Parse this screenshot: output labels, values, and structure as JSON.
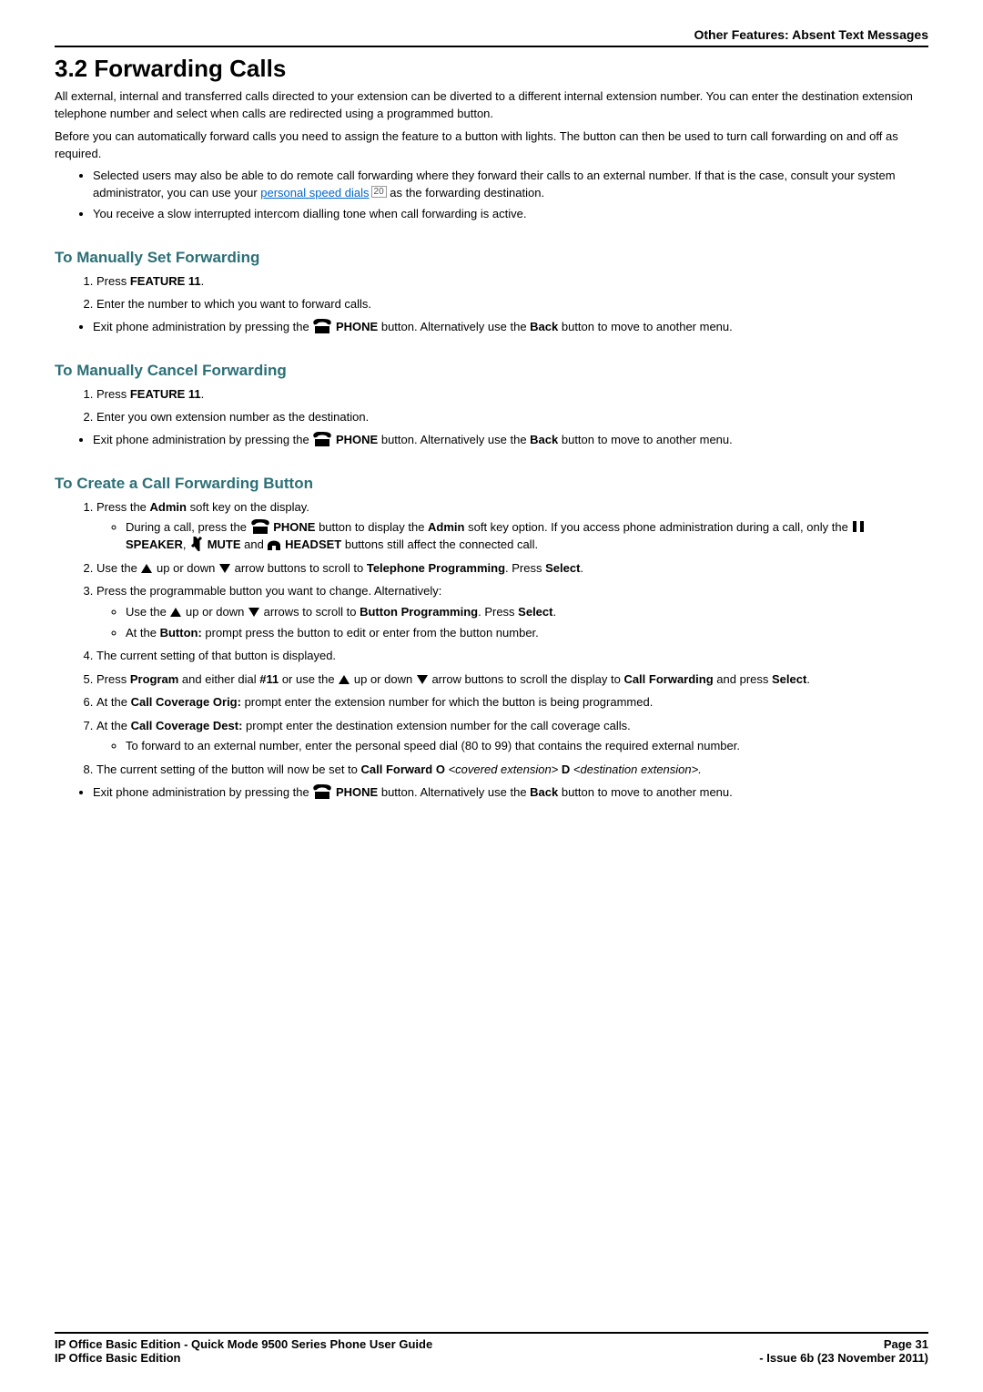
{
  "header": {
    "right": "Other Features: Absent Text Messages"
  },
  "title": "3.2 Forwarding Calls",
  "intro": {
    "p1": "All external, internal and transferred calls directed to your extension can be diverted to a different internal extension number. You can enter the destination extension telephone number and select when calls are redirected using a programmed button.",
    "p2": "Before you can automatically forward calls you need to assign the feature to a button with lights. The button can then be used to turn call forwarding on and off as required.",
    "b1a": "Selected users may also be able to do remote call forwarding where they forward their calls to an external number. If that is the case, consult your system administrator, you can use your ",
    "b1_link": "personal speed dials",
    "b1_sup": "20",
    "b1b": " as the forwarding destination.",
    "b2": "You receive a slow interrupted intercom dialling tone when call forwarding is active."
  },
  "set": {
    "title": "To Manually Set Forwarding",
    "s1a": "Press ",
    "s1b": "FEATURE 11",
    "s1c": ".",
    "s2": "Enter the number to which you want to forward calls.",
    "b1a": "Exit phone administration by pressing the ",
    "b1_phone": "PHONE",
    "b1b": " button. Alternatively use the ",
    "b1_back": "Back",
    "b1c": " button to move to another menu."
  },
  "cancel": {
    "title": "To Manually Cancel Forwarding",
    "s1a": "Press ",
    "s1b": "FEATURE 11",
    "s1c": ".",
    "s2": "Enter you own extension number as the destination.",
    "b1a": "Exit phone administration by pressing the ",
    "b1_phone": "PHONE",
    "b1b": " button. Alternatively use the ",
    "b1_back": "Back",
    "b1c": " button to move to another menu."
  },
  "create": {
    "title": "To Create a Call Forwarding Button",
    "s1a": "Press the ",
    "s1b": "Admin",
    "s1c": " soft key on the display.",
    "sub1a": "During a call, press the ",
    "sub1_phone": "PHONE",
    "sub1b": " button to display the ",
    "sub1_admin": "Admin",
    "sub1c": " soft key option. If you access phone administration during a call, only the ",
    "sub1_speaker": "SPEAKER",
    "sub1d": ", ",
    "sub1_mute": "MUTE",
    "sub1e": " and ",
    "sub1_headset": "HEADSET",
    "sub1f": " buttons still affect the connected call.",
    "s2a": "Use the ",
    "s2b": " up or down ",
    "s2c": " arrow buttons to scroll to ",
    "s2_tp": "Telephone Programming",
    "s2d": ". Press ",
    "s2_sel": "Select",
    "s2e": ".",
    "s3": "Press the programmable button you want to change. Alternatively:",
    "sub3a_a": "Use the ",
    "sub3a_b": " up or down ",
    "sub3a_c": " arrows to scroll to ",
    "sub3a_bp": "Button Programming",
    "sub3a_d": ". Press ",
    "sub3a_sel": "Select",
    "sub3a_e": ".",
    "sub3b_a": "At the ",
    "sub3b_b": "Button:",
    "sub3b_c": " prompt press the button to edit or enter from the button number.",
    "s4": "The current setting of that button is displayed.",
    "s5a": "Press ",
    "s5_prog": "Program",
    "s5b": " and either dial ",
    "s5_code": "#11",
    "s5c": " or use the ",
    "s5d": " up or down ",
    "s5e": " arrow buttons to scroll the display to ",
    "s5_cf": "Call Forwarding",
    "s5f": " and press ",
    "s5_sel": "Select",
    "s5g": ".",
    "s6a": "At the ",
    "s6b": "Call Coverage Orig:",
    "s6c": " prompt enter the extension number for which the button is being programmed.",
    "s7a": "At the ",
    "s7b": "Call Coverage Dest:",
    "s7c": " prompt enter the destination extension number for the call coverage calls.",
    "sub7": "To forward to an external number, enter the personal speed dial (80 to 99) that contains the required external number.",
    "s8a": "The current setting of the button will now be set to ",
    "s8b": "Call Forward O",
    "s8c": " <covered extension> ",
    "s8d": "D",
    "s8e": " <destination extension>.",
    "b1a": "Exit phone administration by pressing the ",
    "b1_phone": "PHONE",
    "b1b": " button. Alternatively use the ",
    "b1_back": "Back",
    "b1c": " button to move to another menu."
  },
  "footer": {
    "l1": "IP Office Basic Edition - Quick Mode 9500 Series Phone User Guide",
    "l2": "IP Office Basic Edition",
    "r1": "Page 31",
    "r2": "- Issue 6b (23 November 2011)"
  }
}
